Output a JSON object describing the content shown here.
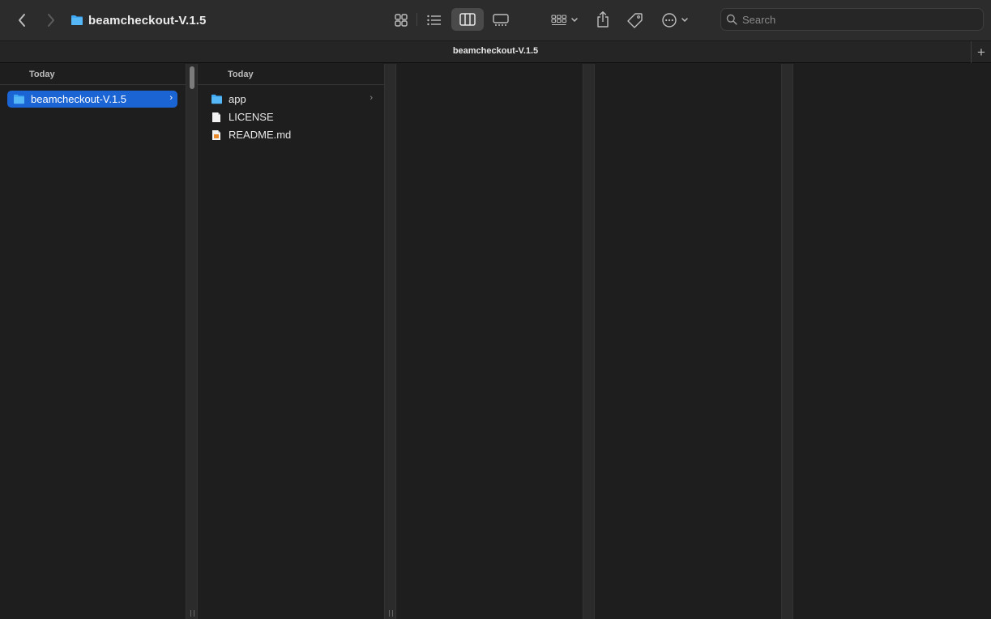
{
  "window": {
    "title": "beamcheckout-V.1.5"
  },
  "toolbar": {
    "back_icon": "chevron-left-icon",
    "forward_icon": "chevron-right-icon",
    "views": [
      "icon-view-icon",
      "list-view-icon",
      "column-view-icon",
      "gallery-view-icon"
    ],
    "active_view": "column-view",
    "group_icon": "group-icon",
    "share_icon": "share-icon",
    "tag_icon": "tag-icon",
    "more_icon": "ellipsis-circle-icon"
  },
  "search": {
    "placeholder": "Search",
    "value": ""
  },
  "tabbar": {
    "title": "beamcheckout-V.1.5",
    "new_tab_label": "+"
  },
  "columns": [
    {
      "header": "Today",
      "items": [
        {
          "name": "beamcheckout-V.1.5",
          "type": "folder",
          "selected": true,
          "has_children": true
        }
      ]
    },
    {
      "header": "Today",
      "items": [
        {
          "name": "app",
          "type": "folder",
          "selected": false,
          "has_children": true
        },
        {
          "name": "LICENSE",
          "type": "document",
          "selected": false,
          "has_children": false
        },
        {
          "name": "README.md",
          "type": "markdown-document",
          "selected": false,
          "has_children": false
        }
      ]
    }
  ],
  "colors": {
    "accent": "#1a64d4",
    "folder": "#3fa9f5",
    "background": "#1e1e1e",
    "toolbar": "#2c2c2c"
  }
}
